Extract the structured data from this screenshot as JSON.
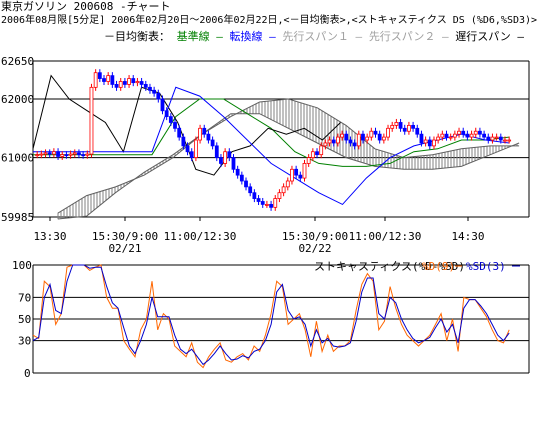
{
  "header": {
    "title": "東京ガソリン 200608 -チャート",
    "subtitle": "2006年08月限[5分足] 2006年02月20日～2006年02月22日,<－目均衡表>,<ストキャスティクス DS (%D6,%SD3)>"
  },
  "legend": {
    "prefix": "－目均衡表：",
    "items": [
      {
        "label": "基準線",
        "color": "#008000"
      },
      {
        "label": "転換線",
        "color": "#0000ff"
      },
      {
        "label": "先行スパン１",
        "color": "#a0a0a0"
      },
      {
        "label": "先行スパン２",
        "color": "#a0a0a0"
      },
      {
        "label": "遅行スパン",
        "color": "#000000"
      }
    ]
  },
  "colors": {
    "up": "#ff0000",
    "down": "#0000ff",
    "kijun": "#008000",
    "tenkan": "#0000ff",
    "chikou": "#000000",
    "cloud": "#808080",
    "pctD": "#ff6600",
    "pctSD": "#0000cc"
  },
  "chart_data": [
    {
      "type": "candlestick",
      "title": "",
      "y_ticks": [
        "62650",
        "62000",
        "61000",
        "59985"
      ],
      "ylim": [
        59985,
        62650
      ],
      "x_tick_labels": [
        {
          "time": "13:30",
          "date": ""
        },
        {
          "time": "15:30/9:00",
          "date": "02/21"
        },
        {
          "time": "11:00/12:30",
          "date": ""
        },
        {
          "time": "15:30/9:00",
          "date": "02/22"
        },
        {
          "time": "11:00/12:30",
          "date": ""
        },
        {
          "time": "14:30",
          "date": ""
        }
      ],
      "kijun": [
        61050,
        61050,
        61050,
        61050,
        61050,
        61050,
        61700,
        62000,
        62000,
        61750,
        61500,
        61100,
        60900,
        60850,
        60850,
        60900,
        61100,
        61150,
        61300,
        61300,
        61350
      ],
      "tenkan": [
        61100,
        61100,
        61100,
        61100,
        61100,
        61100,
        62200,
        62050,
        61700,
        61300,
        60900,
        60650,
        60400,
        60200,
        60650,
        61000,
        61200,
        61300,
        61400,
        61300,
        61250
      ],
      "chikou": [
        61150,
        62400,
        62000,
        61800,
        61600,
        61100,
        62200,
        62100,
        61600,
        60800,
        60700,
        61100,
        61200,
        61500,
        61400,
        61500,
        61300,
        61600
      ],
      "span_a": [
        60050,
        60350,
        60500,
        60700,
        61000,
        61400,
        61700,
        61950,
        62000,
        61850,
        61550,
        61150,
        61000,
        61050,
        61150,
        61200,
        61200
      ],
      "span_b": [
        59950,
        60000,
        60400,
        60750,
        61050,
        61400,
        61750,
        61750,
        61500,
        61250,
        61000,
        60850,
        60800,
        60800,
        60850,
        61050,
        61250
      ],
      "closes": [
        61050,
        61050,
        61060,
        61080,
        61060,
        61100,
        61020,
        61050,
        61040,
        61060,
        61080,
        61050,
        61040,
        61060,
        62200,
        62450,
        62350,
        62300,
        62400,
        62250,
        62200,
        62300,
        62250,
        62350,
        62280,
        62300,
        62250,
        62200,
        62150,
        62100,
        62000,
        61800,
        61700,
        61600,
        61500,
        61350,
        61200,
        61100,
        61000,
        61300,
        61500,
        61400,
        61300,
        61200,
        61000,
        60900,
        61100,
        61000,
        60800,
        60700,
        60600,
        60500,
        60400,
        60300,
        60250,
        60200,
        60200,
        60150,
        60300,
        60400,
        60500,
        60600,
        60800,
        60700,
        60650,
        60900,
        61000,
        61100,
        61050,
        61200,
        61250,
        61300,
        61250,
        61350,
        61400,
        61300,
        61250,
        61200,
        61400,
        61300,
        61350,
        61450,
        61400,
        61300,
        61350,
        61500,
        61550,
        61600,
        61500,
        61450,
        61550,
        61500,
        61400,
        61250,
        61300,
        61200,
        61300,
        61350,
        61400,
        61350,
        61350,
        61400,
        61450,
        61400,
        61350,
        61400,
        61450,
        61400,
        61350,
        61300,
        61350,
        61350,
        61300,
        61300,
        61300
      ]
    },
    {
      "type": "line",
      "title": "ストキャスティクス(%D-%SD)",
      "series": [
        {
          "name": "%D(9)",
          "values": [
            35,
            32,
            85,
            80,
            45,
            55,
            98,
            100,
            100,
            100,
            95,
            98,
            100,
            70,
            60,
            60,
            30,
            22,
            15,
            40,
            50,
            85,
            40,
            55,
            50,
            25,
            20,
            15,
            28,
            10,
            5,
            15,
            22,
            28,
            12,
            10,
            15,
            18,
            12,
            25,
            20,
            35,
            55,
            85,
            80,
            45,
            50,
            55,
            40,
            15,
            48,
            20,
            35,
            20,
            25,
            25,
            30,
            58,
            82,
            92,
            85,
            40,
            48,
            80,
            60,
            45,
            35,
            30,
            25,
            30,
            35,
            45,
            55,
            30,
            50,
            20,
            70,
            68,
            68,
            60,
            52,
            40,
            30,
            28,
            40
          ]
        },
        {
          "name": "%SD(3)",
          "values": [
            30,
            33,
            70,
            82,
            58,
            55,
            85,
            100,
            100,
            100,
            97,
            98,
            98,
            80,
            65,
            60,
            42,
            25,
            18,
            30,
            45,
            70,
            52,
            52,
            52,
            35,
            22,
            18,
            22,
            15,
            8,
            12,
            18,
            25,
            18,
            12,
            13,
            16,
            14,
            20,
            22,
            30,
            45,
            75,
            82,
            58,
            50,
            52,
            45,
            25,
            40,
            28,
            32,
            25,
            24,
            25,
            28,
            48,
            75,
            88,
            88,
            55,
            50,
            70,
            65,
            50,
            40,
            32,
            28,
            30,
            33,
            42,
            50,
            38,
            45,
            28,
            60,
            68,
            68,
            62,
            55,
            45,
            35,
            30,
            37
          ]
        }
      ],
      "y_ticks": [
        "100",
        "70",
        "50",
        "30",
        "0"
      ],
      "ylim": [
        0,
        100
      ],
      "grid": true
    }
  ]
}
